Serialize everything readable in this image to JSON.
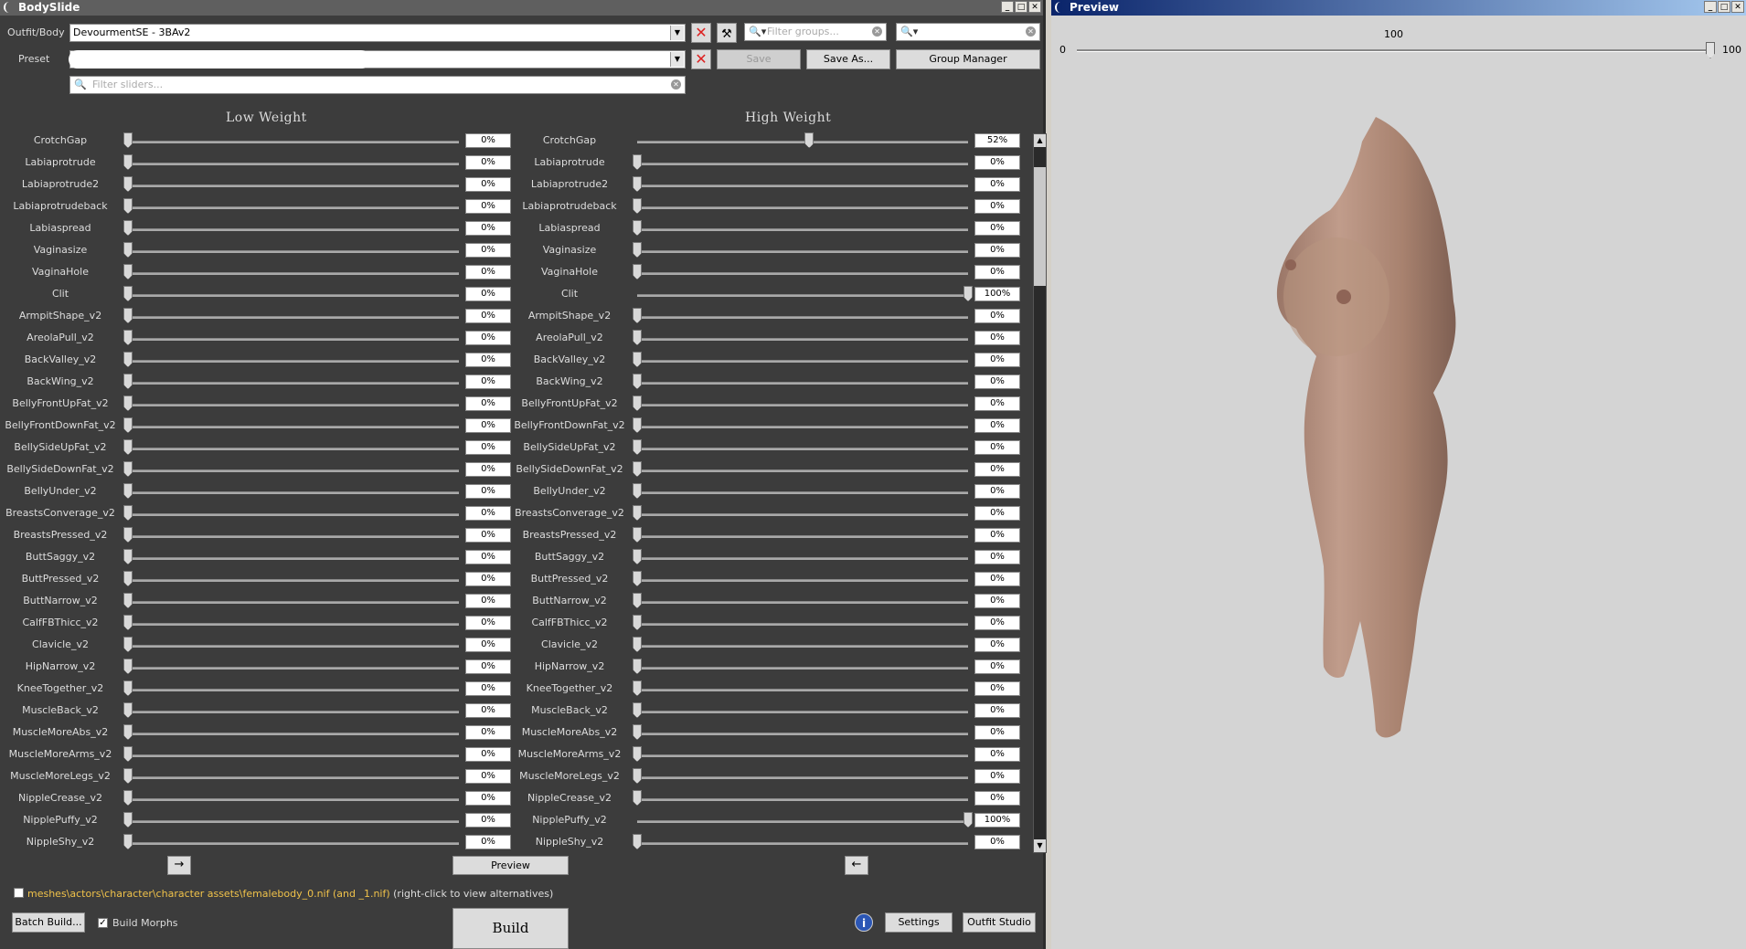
{
  "bodyslide": {
    "title": "BodySlide",
    "outfit_label": "Outfit/Body",
    "outfit_value": "DevourmentSE - 3BAv2",
    "preset_label": "Preset",
    "filter_groups_placeholder": "Filter groups...",
    "filter_sliders_placeholder": "Filter sliders...",
    "filter_outfit_value": "",
    "save_label": "Save",
    "save_as_label": "Save As...",
    "group_manager_label": "Group Manager",
    "low_weight_header": "Low Weight",
    "high_weight_header": "High Weight",
    "sliders": [
      {
        "name": "CrotchGap",
        "low": "0%",
        "high": "52%",
        "low_frac": 0,
        "high_frac": 0.52
      },
      {
        "name": "Labiaprotrude",
        "low": "0%",
        "high": "0%",
        "low_frac": 0,
        "high_frac": 0
      },
      {
        "name": "Labiaprotrude2",
        "low": "0%",
        "high": "0%",
        "low_frac": 0,
        "high_frac": 0
      },
      {
        "name": "Labiaprotrudeback",
        "low": "0%",
        "high": "0%",
        "low_frac": 0,
        "high_frac": 0
      },
      {
        "name": "Labiaspread",
        "low": "0%",
        "high": "0%",
        "low_frac": 0,
        "high_frac": 0
      },
      {
        "name": "Vaginasize",
        "low": "0%",
        "high": "0%",
        "low_frac": 0,
        "high_frac": 0
      },
      {
        "name": "VaginaHole",
        "low": "0%",
        "high": "0%",
        "low_frac": 0,
        "high_frac": 0
      },
      {
        "name": "Clit",
        "low": "0%",
        "high": "100%",
        "low_frac": 0,
        "high_frac": 1
      },
      {
        "name": "ArmpitShape_v2",
        "low": "0%",
        "high": "0%",
        "low_frac": 0,
        "high_frac": 0
      },
      {
        "name": "AreolaPull_v2",
        "low": "0%",
        "high": "0%",
        "low_frac": 0,
        "high_frac": 0
      },
      {
        "name": "BackValley_v2",
        "low": "0%",
        "high": "0%",
        "low_frac": 0,
        "high_frac": 0
      },
      {
        "name": "BackWing_v2",
        "low": "0%",
        "high": "0%",
        "low_frac": 0,
        "high_frac": 0
      },
      {
        "name": "BellyFrontUpFat_v2",
        "low": "0%",
        "high": "0%",
        "low_frac": 0,
        "high_frac": 0
      },
      {
        "name": "BellyFrontDownFat_v2",
        "low": "0%",
        "high": "0%",
        "low_frac": 0,
        "high_frac": 0
      },
      {
        "name": "BellySideUpFat_v2",
        "low": "0%",
        "high": "0%",
        "low_frac": 0,
        "high_frac": 0
      },
      {
        "name": "BellySideDownFat_v2",
        "low": "0%",
        "high": "0%",
        "low_frac": 0,
        "high_frac": 0
      },
      {
        "name": "BellyUnder_v2",
        "low": "0%",
        "high": "0%",
        "low_frac": 0,
        "high_frac": 0
      },
      {
        "name": "BreastsConverage_v2",
        "low": "0%",
        "high": "0%",
        "low_frac": 0,
        "high_frac": 0
      },
      {
        "name": "BreastsPressed_v2",
        "low": "0%",
        "high": "0%",
        "low_frac": 0,
        "high_frac": 0
      },
      {
        "name": "ButtSaggy_v2",
        "low": "0%",
        "high": "0%",
        "low_frac": 0,
        "high_frac": 0
      },
      {
        "name": "ButtPressed_v2",
        "low": "0%",
        "high": "0%",
        "low_frac": 0,
        "high_frac": 0
      },
      {
        "name": "ButtNarrow_v2",
        "low": "0%",
        "high": "0%",
        "low_frac": 0,
        "high_frac": 0
      },
      {
        "name": "CalfFBThicc_v2",
        "low": "0%",
        "high": "0%",
        "low_frac": 0,
        "high_frac": 0
      },
      {
        "name": "Clavicle_v2",
        "low": "0%",
        "high": "0%",
        "low_frac": 0,
        "high_frac": 0
      },
      {
        "name": "HipNarrow_v2",
        "low": "0%",
        "high": "0%",
        "low_frac": 0,
        "high_frac": 0
      },
      {
        "name": "KneeTogether_v2",
        "low": "0%",
        "high": "0%",
        "low_frac": 0,
        "high_frac": 0
      },
      {
        "name": "MuscleBack_v2",
        "low": "0%",
        "high": "0%",
        "low_frac": 0,
        "high_frac": 0
      },
      {
        "name": "MuscleMoreAbs_v2",
        "low": "0%",
        "high": "0%",
        "low_frac": 0,
        "high_frac": 0
      },
      {
        "name": "MuscleMoreArms_v2",
        "low": "0%",
        "high": "0%",
        "low_frac": 0,
        "high_frac": 0
      },
      {
        "name": "MuscleMoreLegs_v2",
        "low": "0%",
        "high": "0%",
        "low_frac": 0,
        "high_frac": 0
      },
      {
        "name": "NippleCrease_v2",
        "low": "0%",
        "high": "0%",
        "low_frac": 0,
        "high_frac": 0
      },
      {
        "name": "NipplePuffy_v2",
        "low": "0%",
        "high": "100%",
        "low_frac": 0,
        "high_frac": 1
      },
      {
        "name": "NippleShy_v2",
        "low": "0%",
        "high": "0%",
        "low_frac": 0,
        "high_frac": 0
      }
    ],
    "copy_right_arrow": "→",
    "copy_left_arrow": "←",
    "preview_label": "Preview",
    "path_text": "meshes\\actors\\character\\character assets\\femalebody_0.nif (and _1.nif)",
    "path_hint": "(right-click to view alternatives)",
    "batch_build_label": "Batch Build...",
    "build_morphs_label": "Build Morphs",
    "build_morphs_checked": true,
    "build_label": "Build",
    "settings_label": "Settings",
    "outfit_studio_label": "Outfit Studio"
  },
  "preview": {
    "title": "Preview",
    "weight_min": "0",
    "weight_max": "100",
    "weight_value": "100",
    "weight_frac": 1
  },
  "icons": {
    "remove": "red-x-icon",
    "tool": "wrench-icon",
    "search": "magnifier-icon",
    "clear": "clear-icon",
    "info": "info-icon"
  }
}
